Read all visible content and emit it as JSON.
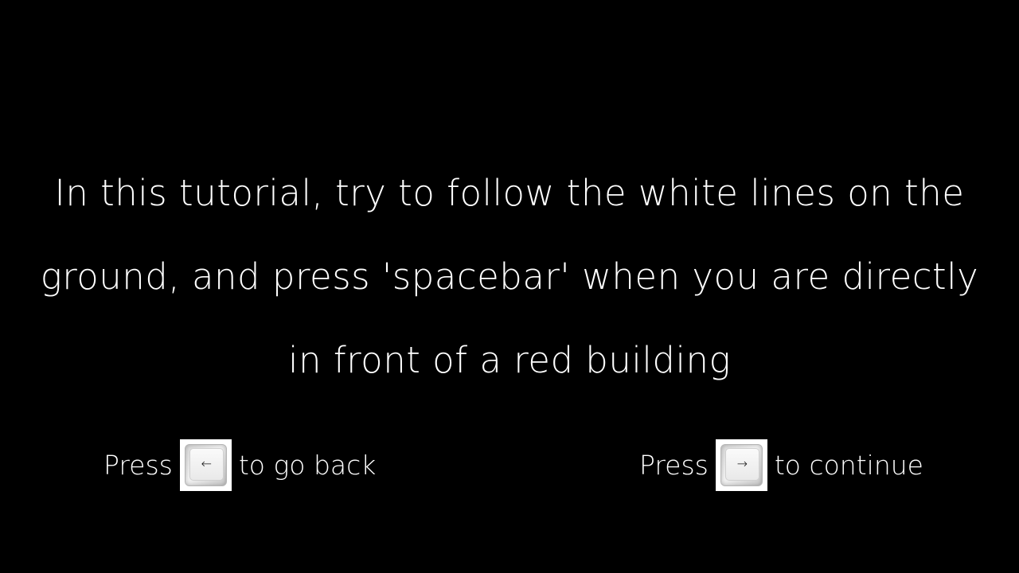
{
  "instruction": {
    "lines": [
      "In this tutorial, try to follow the white lines on the",
      "ground, and press 'spacebar' when you are directly",
      "in front of a red building"
    ]
  },
  "nav_back": {
    "prefix": "Press",
    "key_glyph": "←",
    "key_icon": "left-arrow-key-icon",
    "suffix": "to go back"
  },
  "nav_next": {
    "prefix": "Press",
    "key_glyph": "→",
    "key_icon": "right-arrow-key-icon",
    "suffix": "to continue"
  },
  "colors": {
    "background": "#000000",
    "text": "#ffffff"
  }
}
